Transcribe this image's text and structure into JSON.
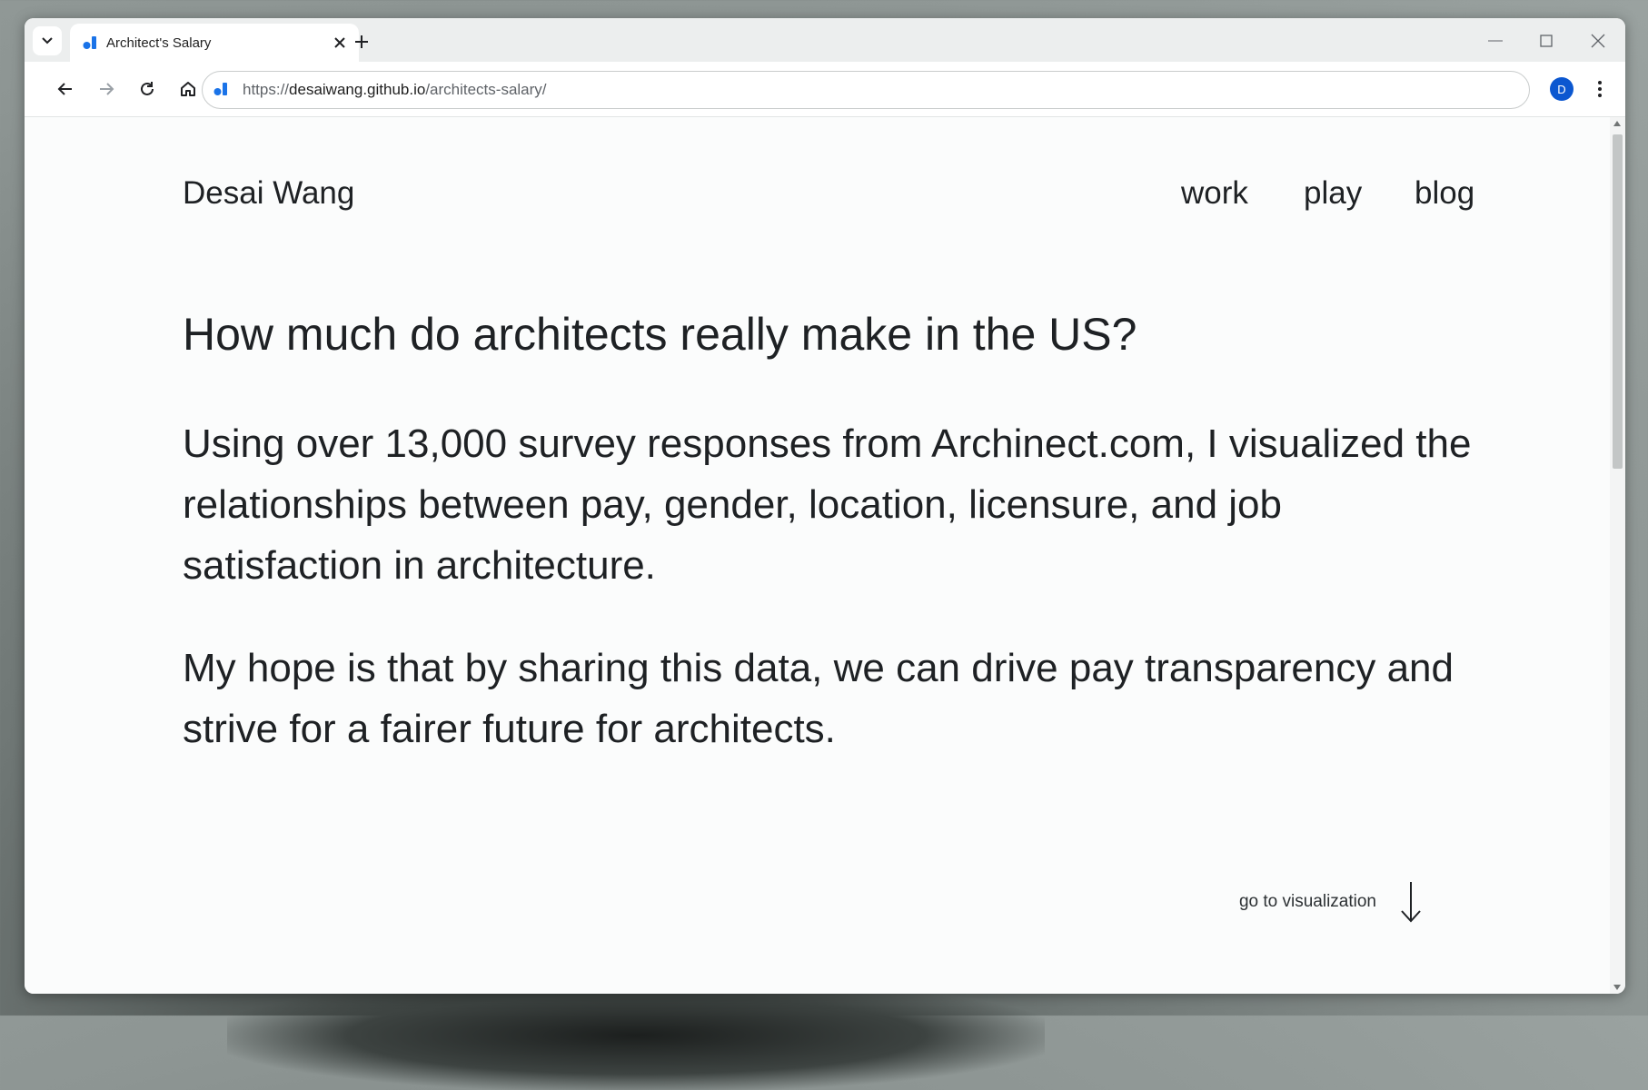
{
  "browser": {
    "tab": {
      "title": "Architect's Salary"
    },
    "url": {
      "prefix": "https://",
      "host": "desaiwang.github.io",
      "path": "/architects-salary/"
    },
    "profile_initial": "D",
    "colors": {
      "accent": "#0b57d0",
      "favicon": "#1a73e8"
    }
  },
  "page": {
    "site_name": "Desai Wang",
    "nav": [
      "work",
      "play",
      "blog"
    ],
    "headline": "How much do architects really make in the US?",
    "paragraphs": [
      "Using over 13,000 survey responses from Archinect.com, I visualized the relationships between pay, gender, location, licensure, and job satisfaction in architecture.",
      "My hope is that by sharing this data, we can drive pay transparency and strive for a fairer future for architects."
    ],
    "cta": {
      "label": "go to visualization",
      "icon": "arrow-down-icon"
    }
  }
}
